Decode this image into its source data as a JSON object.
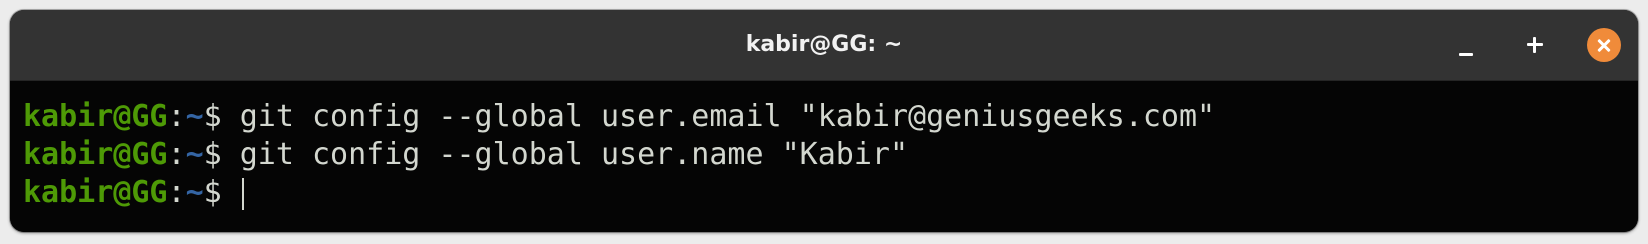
{
  "window": {
    "title": "kabir@GG: ~"
  },
  "controls": {
    "minimize_icon": "minimize-icon",
    "maximize_icon": "maximize-icon",
    "close_icon": "close-icon",
    "close_color": "#f08b3a"
  },
  "terminal": {
    "colors": {
      "background": "#050505",
      "user": "#4e9a06",
      "path": "#3465a4",
      "text": "#d3d7cf"
    },
    "lines": [
      {
        "user": "kabir@GG",
        "colon": ":",
        "path": "~",
        "dollar": "$",
        "command": "git config --global user.email \"kabir@geniusgeeks.com\""
      },
      {
        "user": "kabir@GG",
        "colon": ":",
        "path": "~",
        "dollar": "$",
        "command": "git config --global user.name \"Kabir\""
      },
      {
        "user": "kabir@GG",
        "colon": ":",
        "path": "~",
        "dollar": "$",
        "command": ""
      }
    ]
  }
}
